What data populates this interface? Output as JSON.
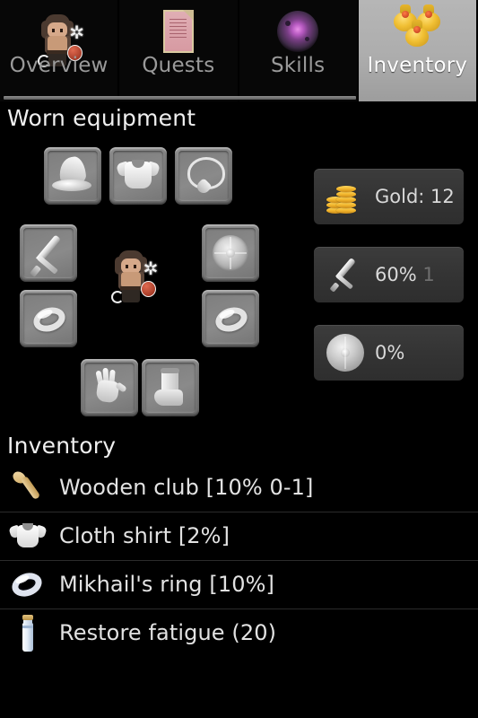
{
  "tabs": [
    {
      "label": "Overview",
      "icon": "hero-sprite-icon",
      "selected": false
    },
    {
      "label": "Quests",
      "icon": "scroll-icon",
      "selected": false
    },
    {
      "label": "Skills",
      "icon": "magic-orb-icon",
      "selected": false
    },
    {
      "label": "Inventory",
      "icon": "gold-pouches-icon",
      "selected": true
    }
  ],
  "worn_equipment": {
    "title": "Worn equipment",
    "slots": [
      {
        "name": "head",
        "icon": "hat-icon",
        "position": "top-left"
      },
      {
        "name": "body",
        "icon": "shirt-icon",
        "position": "top-center"
      },
      {
        "name": "neck",
        "icon": "amulet-icon",
        "position": "top-right"
      },
      {
        "name": "weapon",
        "icon": "sword-icon",
        "position": "left-upper"
      },
      {
        "name": "ring-left",
        "icon": "ring-icon",
        "position": "left-lower"
      },
      {
        "name": "shield",
        "icon": "shield-icon",
        "position": "right-upper"
      },
      {
        "name": "ring-right",
        "icon": "ring-icon",
        "position": "right-lower"
      },
      {
        "name": "hands",
        "icon": "glove-icon",
        "position": "bottom-left"
      },
      {
        "name": "feet",
        "icon": "boot-icon",
        "position": "bottom-right"
      }
    ],
    "character_icon": "hero-sprite-icon"
  },
  "stats": [
    {
      "name": "gold",
      "icon": "gold-coins-icon",
      "value": "Gold: 12",
      "suffix": ""
    },
    {
      "name": "attack",
      "icon": "sword-icon",
      "value": "60%",
      "suffix": "1"
    },
    {
      "name": "defence",
      "icon": "shield-icon",
      "value": "0%",
      "suffix": ""
    }
  ],
  "inventory": {
    "title": "Inventory",
    "items": [
      {
        "icon": "wooden-club-icon",
        "label": "Wooden club [10% 0-1]"
      },
      {
        "icon": "cloth-shirt-icon",
        "label": "Cloth shirt [2%]"
      },
      {
        "icon": "ring-icon",
        "label": "Mikhail's ring [10%]"
      },
      {
        "icon": "potion-vial-icon",
        "label": "Restore fatigue (20)"
      }
    ]
  },
  "colors": {
    "background": "#000000",
    "selected_tab": "#adadad",
    "tab_label": "#9a9a9a",
    "selected_tab_label": "#ffffff",
    "panel": "#343434",
    "text": "#e2e2e2",
    "gold": "#f0b32a",
    "divider": "#2b2b2b"
  }
}
